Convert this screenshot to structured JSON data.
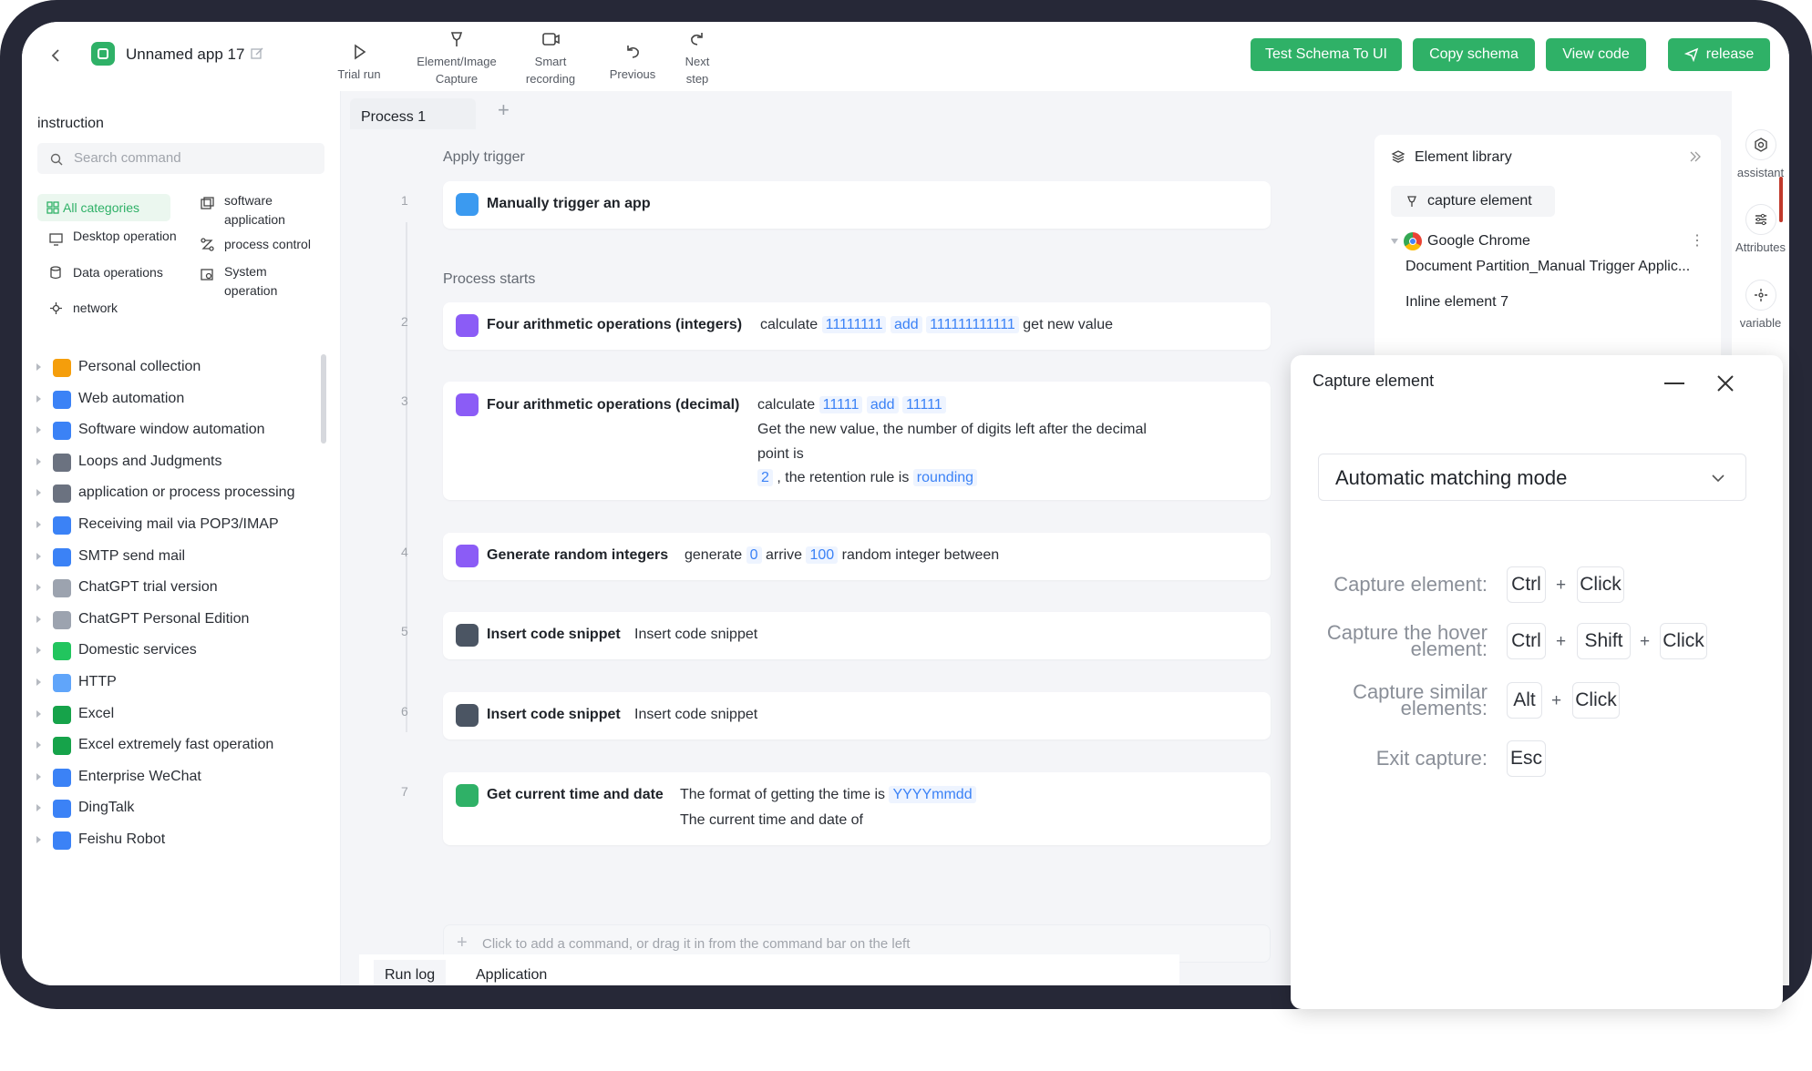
{
  "topbar": {
    "app_name": "Unnamed app 17",
    "tools": [
      {
        "label": "Trial run",
        "icon": "play-icon"
      },
      {
        "label": "Element/Image Capture",
        "icon": "pin-icon"
      },
      {
        "label": "Smart recording",
        "icon": "record-icon"
      },
      {
        "label": "Previous",
        "icon": "undo-icon"
      },
      {
        "label": "Next step",
        "icon": "redo-icon"
      }
    ],
    "buttons": {
      "test_schema": "Test Schema To UI",
      "copy_schema": "Copy schema",
      "view_code": "View code",
      "release": "release"
    },
    "accent_color": "#2fb167"
  },
  "left": {
    "title": "instruction",
    "search_placeholder": "Search command",
    "categories": [
      {
        "label": "All categories",
        "icon": "grid-icon",
        "selected": true
      },
      {
        "label": "software application",
        "icon": "window-icon"
      },
      {
        "label": "Desktop operation",
        "icon": "monitor-icon"
      },
      {
        "label": "process control",
        "icon": "flow-icon"
      },
      {
        "label": "Data operations",
        "icon": "database-icon"
      },
      {
        "label": "System operation",
        "icon": "system-icon"
      },
      {
        "label": "network",
        "icon": "network-icon"
      }
    ],
    "tree": [
      {
        "label": "Personal collection",
        "color": "#f59e0b"
      },
      {
        "label": "Web automation",
        "color": "#3b82f6"
      },
      {
        "label": "Software window automation",
        "color": "#3b82f6"
      },
      {
        "label": "Loops and Judgments",
        "color": "#6b7280"
      },
      {
        "label": "application or process processing",
        "color": "#6b7280"
      },
      {
        "label": "Receiving mail via POP3/IMAP",
        "color": "#3b82f6"
      },
      {
        "label": "SMTP send mail",
        "color": "#3b82f6"
      },
      {
        "label": "ChatGPT trial version",
        "color": "#9ca3af"
      },
      {
        "label": "ChatGPT Personal Edition",
        "color": "#9ca3af"
      },
      {
        "label": "Domestic services",
        "color": "#22c55e"
      },
      {
        "label": "HTTP",
        "color": "#60a5fa"
      },
      {
        "label": "Excel",
        "color": "#16a34a"
      },
      {
        "label": "Excel extremely fast operation",
        "color": "#16a34a"
      },
      {
        "label": "Enterprise WeChat",
        "color": "#3b82f6"
      },
      {
        "label": "DingTalk",
        "color": "#3b82f6"
      },
      {
        "label": "Feishu Robot",
        "color": "#3b82f6"
      }
    ]
  },
  "center": {
    "tab": "Process 1",
    "sections": {
      "trigger": "Apply trigger",
      "process": "Process starts"
    },
    "steps": {
      "s1": {
        "num": "1",
        "title": "Manually trigger an app"
      },
      "s2": {
        "num": "2",
        "title": "Four arithmetic operations (integers)",
        "t1": "calculate",
        "v1": "11111111",
        "op": "add",
        "v2": "111111111111",
        "t2": "get new value"
      },
      "s3": {
        "num": "3",
        "title": "Four arithmetic operations (decimal)",
        "t1": "calculate",
        "v1": "11111",
        "op": "add",
        "v2": "11111",
        "t2": "Get the new value, the number of digits left after the decimal",
        "t3": "point is",
        "v3": "2",
        "t4": ", the retention rule is",
        "v4": "rounding"
      },
      "s4": {
        "num": "4",
        "title": "Generate random integers",
        "t1": "generate",
        "v1": "0",
        "t2": "arrive",
        "v2": "100",
        "t3": "random integer between"
      },
      "s5": {
        "num": "5",
        "title": "Insert code snippet",
        "t1": "Insert code snippet"
      },
      "s6": {
        "num": "6",
        "title": "Insert code snippet",
        "t1": "Insert code snippet"
      },
      "s7": {
        "num": "7",
        "title": "Get current time and date",
        "t1": "The format of getting the time is",
        "v1": "YYYYmmdd",
        "t2": "The current time and date of"
      }
    },
    "add_hint": "Click to add a command, or drag it in from the command bar on the left",
    "bottom_tabs": [
      "Run log",
      "Application"
    ]
  },
  "library": {
    "title": "Element library",
    "capture_btn": "capture element",
    "browser": "Google Chrome",
    "doc": "Document Partition_Manual Trigger Applic...",
    "inline": "Inline element 7"
  },
  "rail": {
    "assistant": "assistant",
    "attributes": "Attributes",
    "variable": "variable"
  },
  "capture": {
    "title": "Capture element",
    "mode": "Automatic matching mode",
    "rows": {
      "r1": {
        "label": "Capture element:",
        "keys": [
          "Ctrl",
          "Click"
        ]
      },
      "r2": {
        "label1": "Capture the hover",
        "label2": "element:",
        "keys": [
          "Ctrl",
          "Shift",
          "Click"
        ]
      },
      "r3": {
        "label1": "Capture similar",
        "label2": "elements:",
        "keys": [
          "Alt",
          "Click"
        ]
      },
      "r4": {
        "label": "Exit capture:",
        "keys": [
          "Esc"
        ]
      }
    },
    "plus": "+"
  }
}
